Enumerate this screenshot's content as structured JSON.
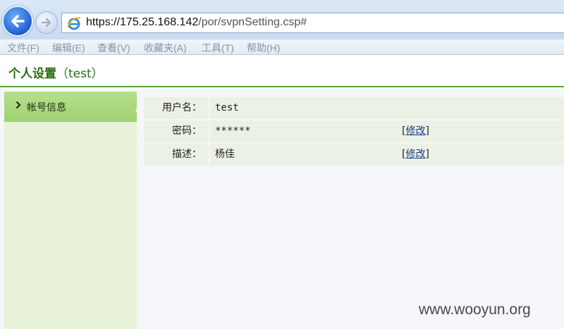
{
  "browser": {
    "url_host": "https://175.25.168.142",
    "url_path": "/por/svpnSetting.csp#",
    "menu": [
      "文件(F)",
      "编辑(E)",
      "查看(V)",
      "收藏夹(A)",
      "工具(T)",
      "帮助(H)"
    ],
    "icons": {
      "back": "arrow-left-icon",
      "forward": "arrow-right-icon",
      "site": "ie-logo-icon"
    }
  },
  "page": {
    "title": "个人设置",
    "title_user": "（test）"
  },
  "sidebar": {
    "items": [
      {
        "label": "帐号信息",
        "icon": "chevron-right-icon",
        "active": true
      }
    ]
  },
  "account": {
    "rows": [
      {
        "key": "用户名：",
        "value": "test",
        "action": ""
      },
      {
        "key": "密码：",
        "value": "******",
        "action_open": "[",
        "action": "修改",
        "action_close": "]"
      },
      {
        "key": "描述：",
        "value": "杨佳",
        "action_open": "[",
        "action": "修改",
        "action_close": "]"
      }
    ]
  },
  "watermark": "www.wooyun.org",
  "colors": {
    "accent": "#2a6e12",
    "header_rule": "#5aa832",
    "sidebar_active": "#a8d67c",
    "sidebar_bg": "#e8f2d8",
    "row_bg": "#ecf1e5"
  }
}
